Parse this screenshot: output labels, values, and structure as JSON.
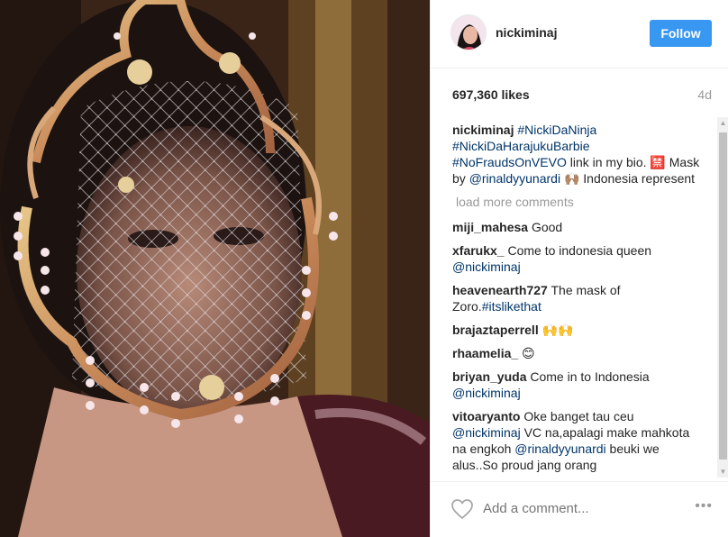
{
  "post": {
    "username": "nickiminaj",
    "follow_label": "Follow",
    "likes": "697,360 likes",
    "time_ago": "4d"
  },
  "caption": {
    "user": "nickiminaj",
    "tag1": "#NickiDaNinja",
    "tag2": "#NickiDaHarajukuBarbie",
    "tag3": "#NoFraudsOnVEVO",
    "text1": " link in my bio. 🈲",
    "text2": "Mask by ",
    "mention": "@rinaldyyunardi",
    "text3": " 🙌🏽 Indonesia represent"
  },
  "load_more": "load more comments",
  "comments": [
    {
      "user": "miji_mahesa",
      "text": " Good"
    },
    {
      "user": "xfarukx_",
      "text": " Come to indonesia queen ",
      "mention": "@nickiminaj"
    },
    {
      "user": "heavenearth727",
      "text": " The mask of Zoro.",
      "tag": "#itslikethat"
    },
    {
      "user": "brajaztaperrell",
      "text": " 🙌🙌"
    },
    {
      "user": "rhaamelia_",
      "text": " 😊"
    },
    {
      "user": "briyan_yuda",
      "text": " Come in to Indonesia ",
      "mention": "@nickiminaj"
    },
    {
      "user": "vitoaryanto",
      "text1": " Oke banget tau ceu ",
      "mention1": "@nickiminaj",
      "text2": " VC na,apalagi make mahkota na engkoh ",
      "mention2": "@rinaldyyunardi",
      "text3": " beuki we alus..So proud jang orang"
    }
  ],
  "add_comment_placeholder": "Add a comment...",
  "more_options": "•••",
  "colors": {
    "follow_bg": "#3897f0",
    "link": "#003569",
    "muted": "#999999"
  }
}
